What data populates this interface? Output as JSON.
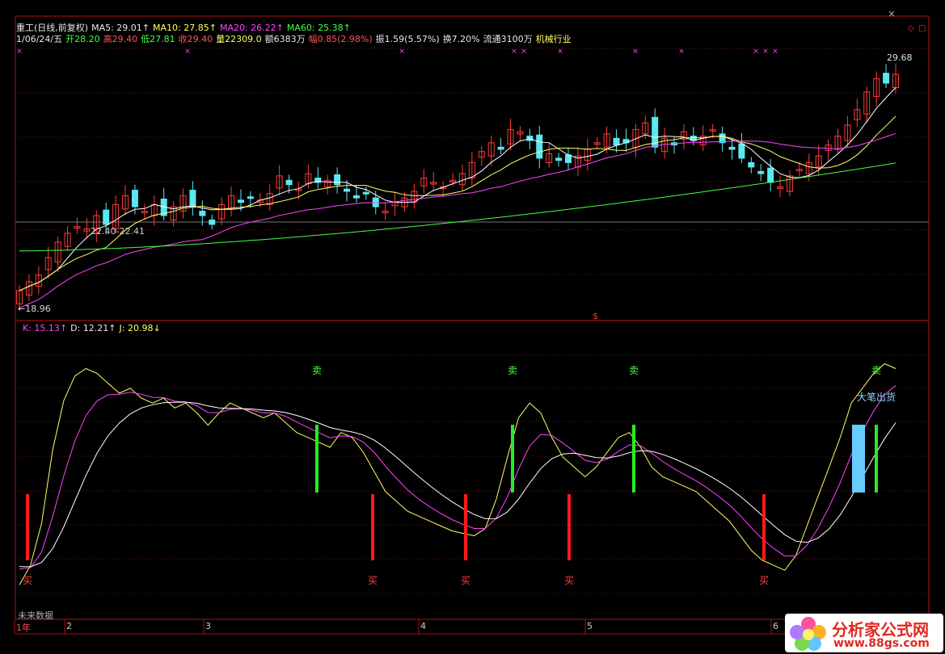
{
  "header": {
    "line1": [
      {
        "text": "重工(日线,前复权)",
        "color": "#e8e8e8"
      },
      {
        "text": "MA5: 29.01↑",
        "color": "#e8e8e8"
      },
      {
        "text": "MA10: 27.85↑",
        "color": "#ffff66"
      },
      {
        "text": "MA20: 26.22↑",
        "color": "#ff44ff"
      },
      {
        "text": "MA60: 25.38↑",
        "color": "#44ff44"
      }
    ],
    "line2": [
      {
        "text": "1/06/24/五",
        "color": "#e8e8e8"
      },
      {
        "text": "开28.20",
        "color": "#44ff44"
      },
      {
        "text": "高29.40",
        "color": "#ff5555"
      },
      {
        "text": "低27.81",
        "color": "#44ff44"
      },
      {
        "text": "收29.40",
        "color": "#ff5555"
      },
      {
        "text": "量22309.0",
        "color": "#ffff66"
      },
      {
        "text": "额6383万",
        "color": "#e8e8e8"
      },
      {
        "text": "幅0.85(2.98%)",
        "color": "#ff5555"
      },
      {
        "text": "振1.59(5.57%)",
        "color": "#e8e8e8"
      },
      {
        "text": "换7.20%",
        "color": "#e8e8e8"
      },
      {
        "text": "流通3100万",
        "color": "#e8e8e8"
      },
      {
        "text": "机械行业",
        "color": "#ffff66"
      }
    ]
  },
  "price_annotations": {
    "high_label": "29.68",
    "low_label": "←18.96",
    "range_label": "22.40-22.41",
    "dollar_mark": "$"
  },
  "indicator_header": [
    {
      "text": "K: 15.13↑",
      "color": "#ff44ff"
    },
    {
      "text": "D: 12.21↑",
      "color": "#e8e8e8"
    },
    {
      "text": "J: 20.98↓",
      "color": "#ffff66"
    }
  ],
  "signals": {
    "sell_label": "卖",
    "buy_label": "买",
    "big_sell_label": "大笔出货",
    "future_label": "未来数据"
  },
  "time_axis": [
    "1年",
    "2",
    "3",
    "4",
    "5",
    "6"
  ],
  "colors": {
    "up": "#ff3b3b",
    "down": "#5ce8f2",
    "ma5": "#ffffff",
    "ma10": "#ffff66",
    "ma20": "#ff44ff",
    "ma60": "#44ff44",
    "buy_bar": "#ff1a1a",
    "sell_bar": "#22ee22",
    "big_bar": "#66ccff"
  },
  "watermark": {
    "title": "分析家公式网",
    "url": "www.88gs.com"
  },
  "chart_data": [
    {
      "type": "candlestick",
      "x": [
        "1年",
        "2",
        "3",
        "4",
        "5",
        "6"
      ],
      "ohlc_summary": {
        "first_low": 18.96,
        "last_high": 29.68,
        "last_open": 28.2,
        "last_high_day": 29.4,
        "last_low": 27.81,
        "last_close": 29.4
      },
      "series": [
        {
          "name": "MA5",
          "last": 29.01
        },
        {
          "name": "MA10",
          "last": 27.85
        },
        {
          "name": "MA20",
          "last": 26.22
        },
        {
          "name": "MA60",
          "last": 25.38
        }
      ]
    },
    {
      "type": "line",
      "series": [
        {
          "name": "K",
          "last": 15.13
        },
        {
          "name": "D",
          "last": 12.21
        },
        {
          "name": "J",
          "last": 20.98
        }
      ],
      "signals": [
        {
          "type": "买",
          "index": 1
        },
        {
          "type": "卖",
          "index": 30
        },
        {
          "type": "买",
          "index": 37
        },
        {
          "type": "买",
          "index": 47
        },
        {
          "type": "卖",
          "index": 52
        },
        {
          "type": "买",
          "index": 59
        },
        {
          "type": "卖",
          "index": 65
        },
        {
          "type": "买",
          "index": 80
        },
        {
          "type": "大笔出货",
          "index": 89
        },
        {
          "type": "卖",
          "index": 91
        }
      ]
    }
  ]
}
